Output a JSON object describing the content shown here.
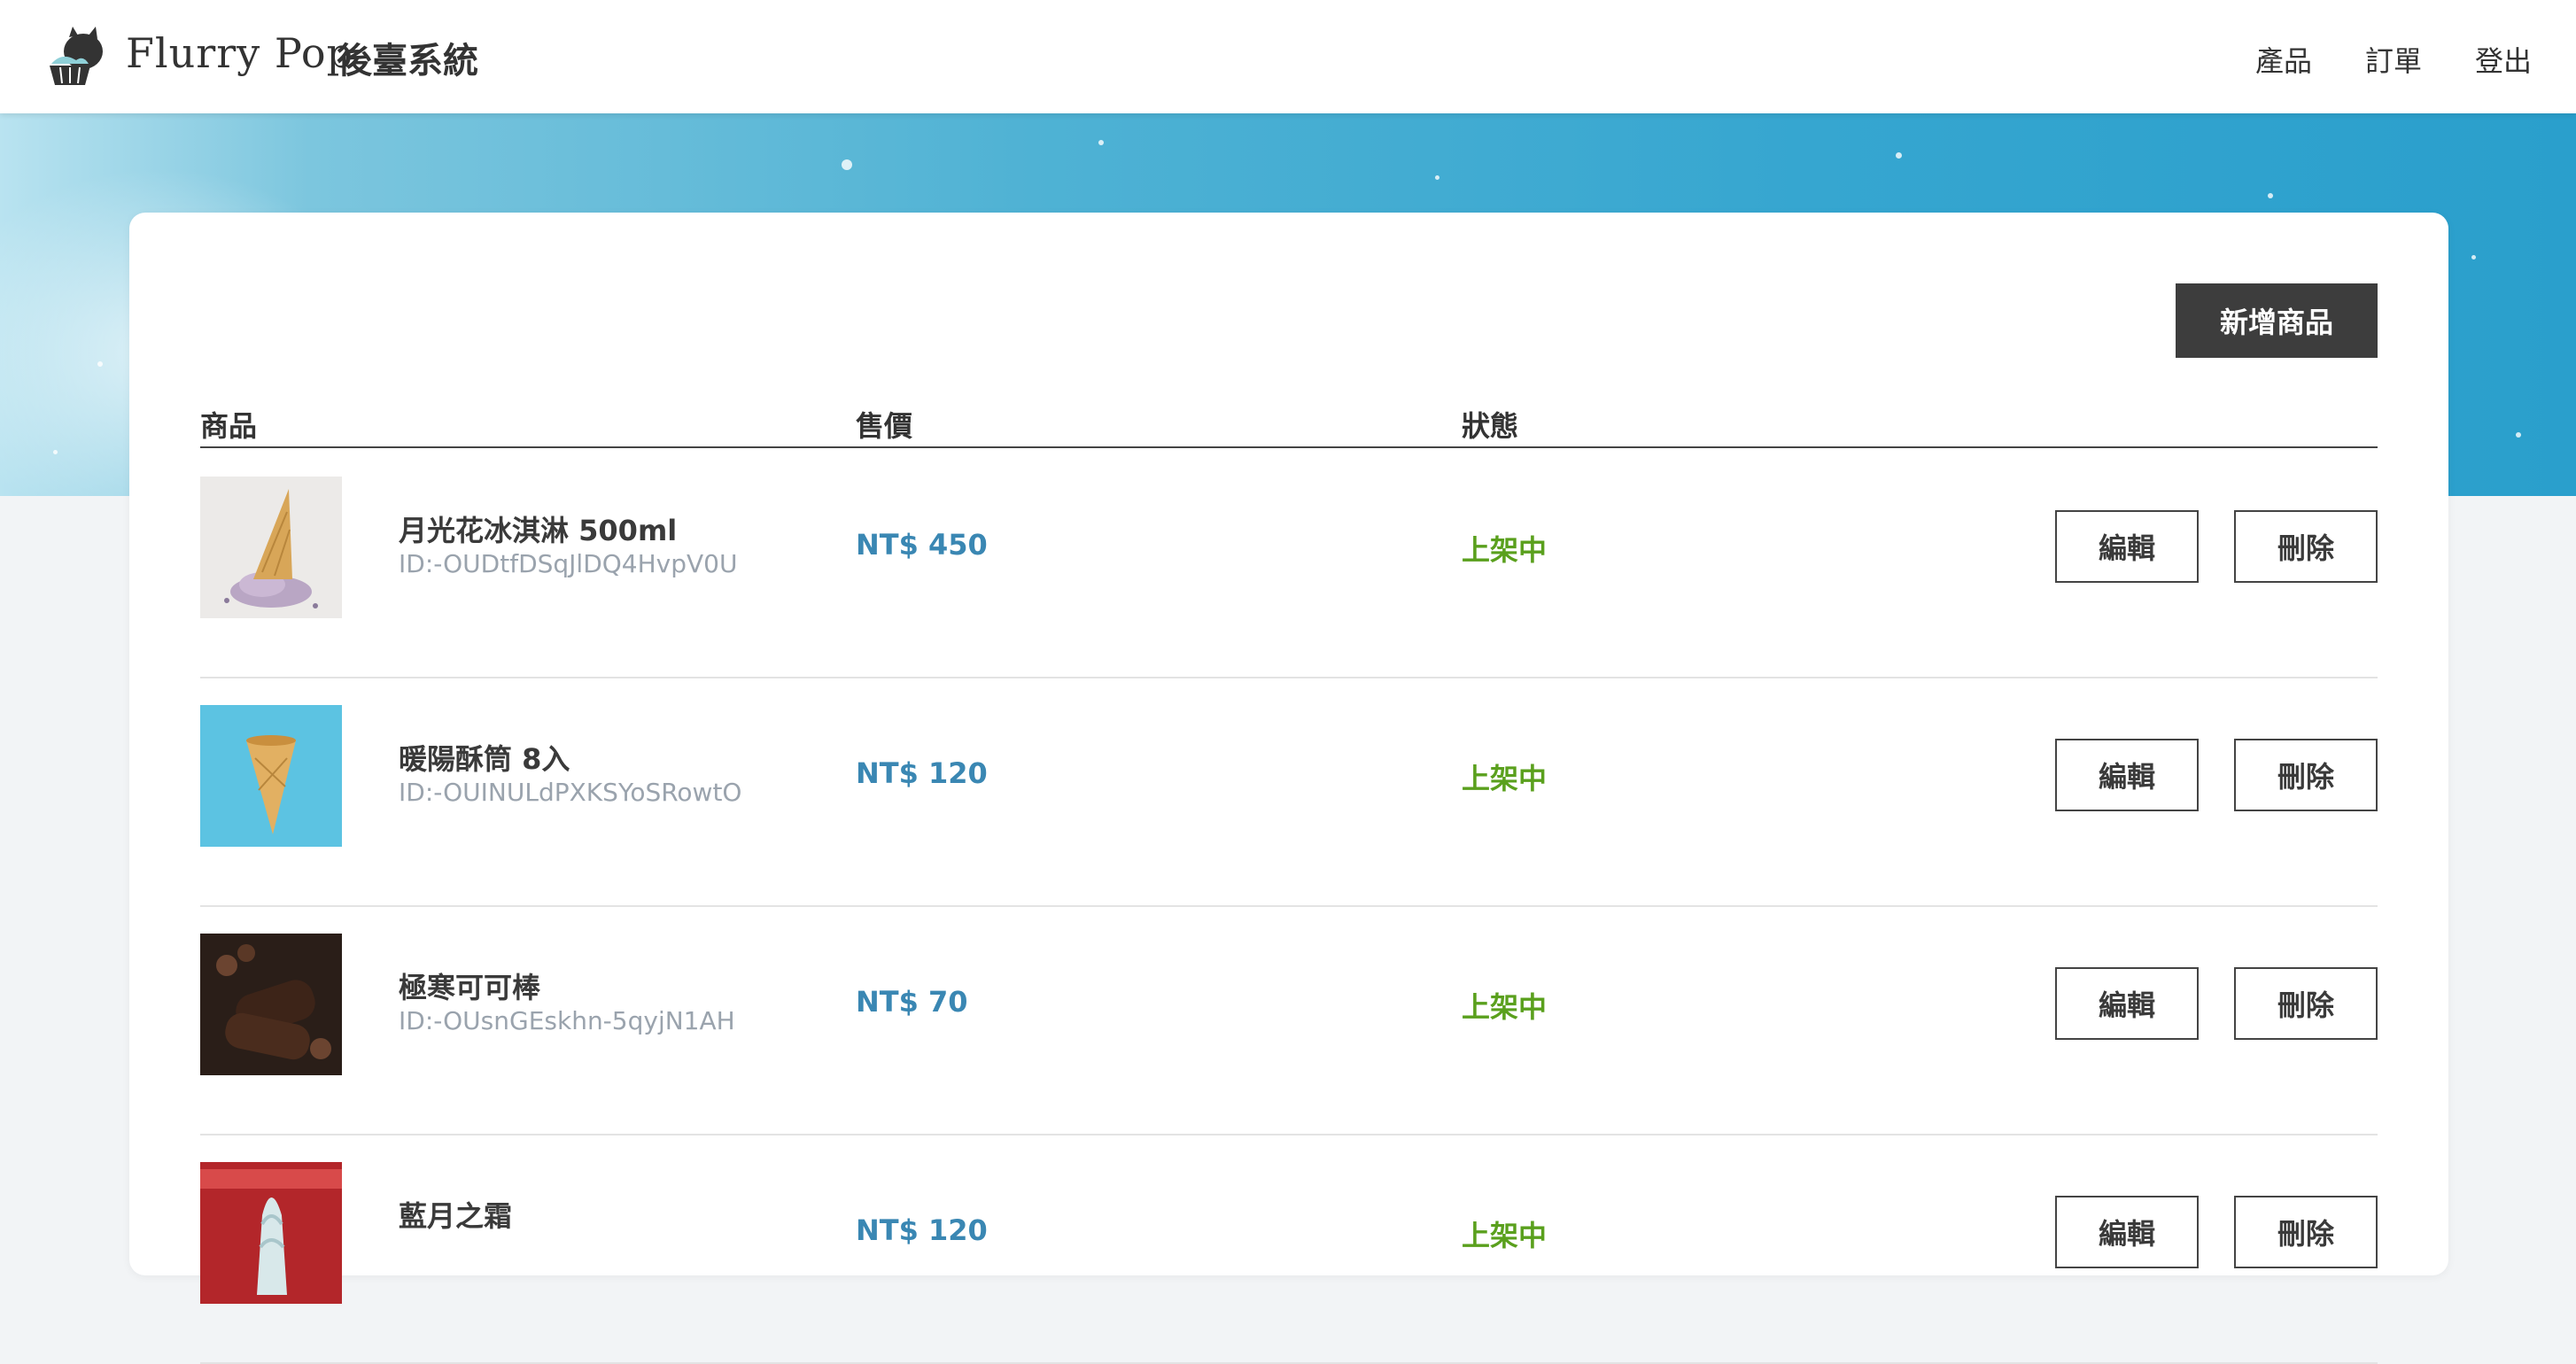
{
  "header": {
    "brand": "Flurry Pop",
    "subtitle": "後臺系統",
    "nav": [
      "產品",
      "訂單",
      "登出"
    ]
  },
  "actions": {
    "add_product": "新增商品"
  },
  "table": {
    "columns": [
      "商品",
      "售價",
      "狀態"
    ],
    "rows": [
      {
        "name": "月光花冰淇淋 500ml",
        "id": "ID:-OUDtfDSqJlDQ4HvpV0U",
        "price": "NT$ 450",
        "status": "上架中",
        "edit": "編輯",
        "delete": "刪除"
      },
      {
        "name": "暖陽酥筒 8入",
        "id": "ID:-OUINULdPXKSYoSRowtO",
        "price": "NT$ 120",
        "status": "上架中",
        "edit": "編輯",
        "delete": "刪除"
      },
      {
        "name": "極寒可可棒",
        "id": "ID:-OUsnGEskhn-5qyjN1AH",
        "price": "NT$ 70",
        "status": "上架中",
        "edit": "編輯",
        "delete": "刪除"
      },
      {
        "name": "藍月之霜",
        "id": "",
        "price": "NT$ 120",
        "status": "上架中",
        "edit": "編輯",
        "delete": "刪除"
      }
    ]
  },
  "colors": {
    "price": "#3a87b3",
    "status_active": "#5aa01d",
    "primary_button": "#3d3d3d"
  }
}
